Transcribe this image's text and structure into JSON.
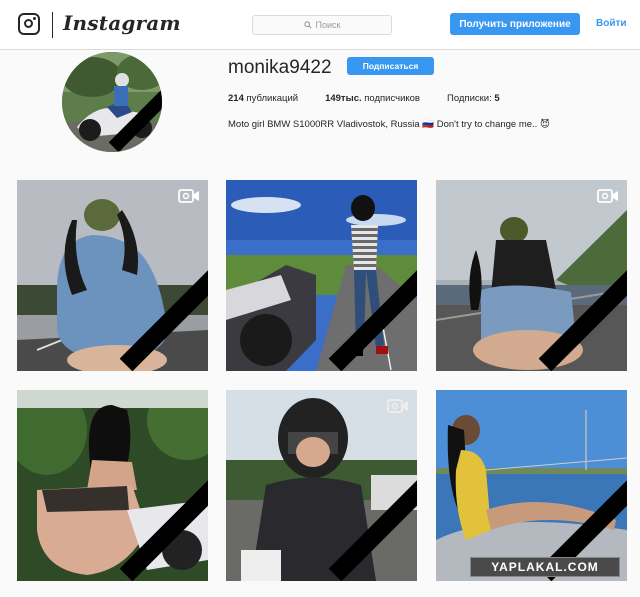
{
  "header": {
    "brand": "Instagram",
    "search_placeholder": "Поиск",
    "get_app_label": "Получить приложение",
    "login_label": "Войти"
  },
  "profile": {
    "username": "monika9422",
    "follow_label": "Подписаться",
    "posts_count": "214",
    "posts_label": "публикаций",
    "followers_count": "149тыс.",
    "followers_label": "подписчиков",
    "following_label": "Подписки:",
    "following_count": "5",
    "bio": "Moto girl BMW S1000RR Vladivostok, Russia 🇷🇺 Don't try to change me.. 😈"
  },
  "posts": [
    {
      "type": "video",
      "scene": "girl-blue-dress-on-road"
    },
    {
      "type": "photo",
      "scene": "girl-helmet-next-to-bike"
    },
    {
      "type": "video",
      "scene": "girl-denim-shorts-on-bike"
    },
    {
      "type": "photo",
      "scene": "girl-lace-on-bike-forest"
    },
    {
      "type": "video",
      "scene": "girl-helmet-selfie"
    },
    {
      "type": "photo",
      "scene": "girl-yellow-swimsuit-by-sea"
    }
  ],
  "watermark": "YAPLAKAL.COM",
  "colors": {
    "accent": "#3897f0",
    "mourning_ribbon": "#000000"
  }
}
